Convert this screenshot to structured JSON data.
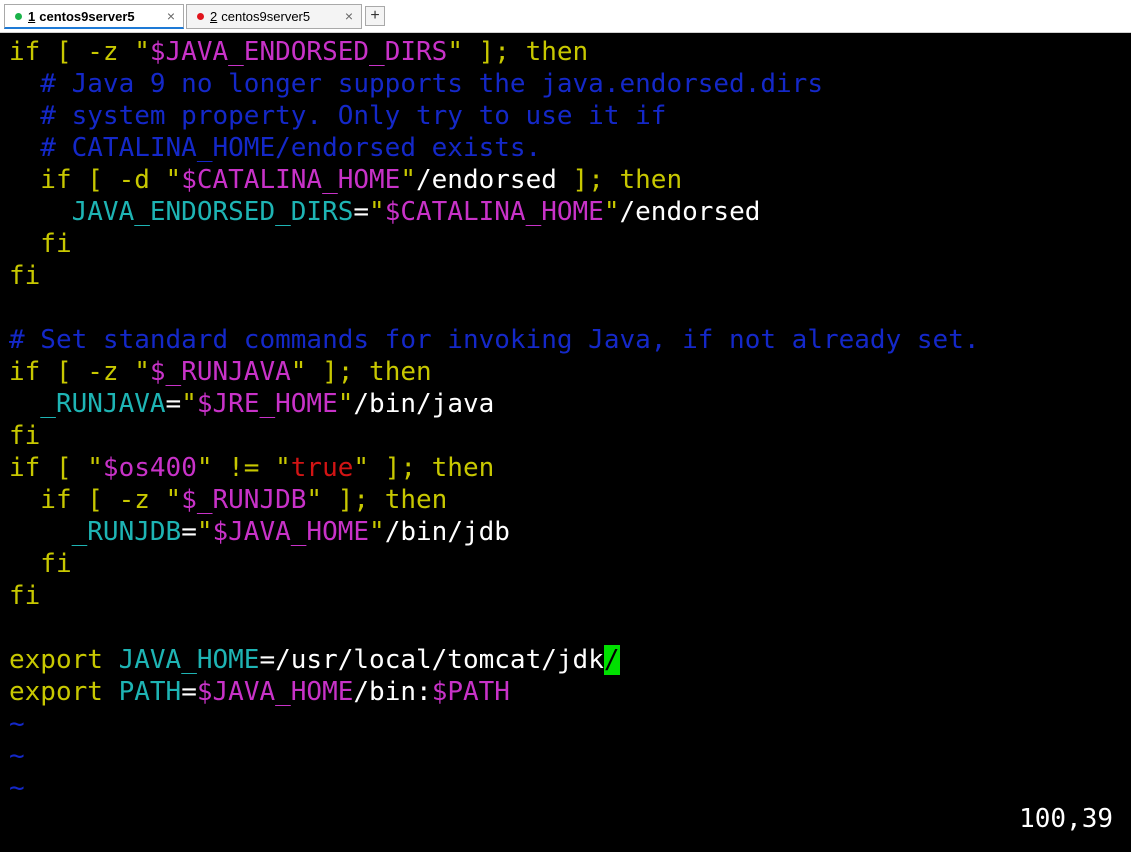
{
  "tabs": [
    {
      "number": "1",
      "title": "centos9server5",
      "dot_color": "#1bb34a",
      "active": true,
      "close": "×"
    },
    {
      "number": "2",
      "title": "centos9server5",
      "dot_color": "#e0141c",
      "active": false,
      "close": "×"
    }
  ],
  "new_tab_label": "+",
  "colors": {
    "yellow": "#c8c800",
    "magenta": "#c832c8",
    "blue": "#1428c8",
    "cyan": "#1eb4b4",
    "red": "#d21414",
    "white": "#ffffff",
    "cursor": "#00e000"
  },
  "editor": {
    "lines": [
      [
        {
          "t": "if [ -z \"",
          "c": "yellow"
        },
        {
          "t": "$JAVA_ENDORSED_DIRS",
          "c": "magenta"
        },
        {
          "t": "\" ]; then",
          "c": "yellow"
        }
      ],
      [
        {
          "t": "  # Java 9 no longer supports the java.endorsed.dirs",
          "c": "blue"
        }
      ],
      [
        {
          "t": "  # system property. Only try to use it if",
          "c": "blue"
        }
      ],
      [
        {
          "t": "  # CATALINA_HOME/endorsed exists.",
          "c": "blue"
        }
      ],
      [
        {
          "t": "  if [ -d \"",
          "c": "yellow"
        },
        {
          "t": "$CATALINA_HOME",
          "c": "magenta"
        },
        {
          "t": "\"",
          "c": "yellow"
        },
        {
          "t": "/endorsed",
          "c": "white"
        },
        {
          "t": " ]; then",
          "c": "yellow"
        }
      ],
      [
        {
          "t": "    JAVA_ENDORSED_DIRS",
          "c": "cyan"
        },
        {
          "t": "=",
          "c": "white"
        },
        {
          "t": "\"",
          "c": "yellow"
        },
        {
          "t": "$CATALINA_HOME",
          "c": "magenta"
        },
        {
          "t": "\"",
          "c": "yellow"
        },
        {
          "t": "/endorsed",
          "c": "white"
        }
      ],
      [
        {
          "t": "  fi",
          "c": "yellow"
        }
      ],
      [
        {
          "t": "fi",
          "c": "yellow"
        }
      ],
      [],
      [
        {
          "t": "# Set standard commands for invoking Java, if not already set.",
          "c": "blue"
        }
      ],
      [
        {
          "t": "if [ -z \"",
          "c": "yellow"
        },
        {
          "t": "$_RUNJAVA",
          "c": "magenta"
        },
        {
          "t": "\" ]; then",
          "c": "yellow"
        }
      ],
      [
        {
          "t": "  _RUNJAVA",
          "c": "cyan"
        },
        {
          "t": "=",
          "c": "white"
        },
        {
          "t": "\"",
          "c": "yellow"
        },
        {
          "t": "$JRE_HOME",
          "c": "magenta"
        },
        {
          "t": "\"",
          "c": "yellow"
        },
        {
          "t": "/bin/java",
          "c": "white"
        }
      ],
      [
        {
          "t": "fi",
          "c": "yellow"
        }
      ],
      [
        {
          "t": "if [ \"",
          "c": "yellow"
        },
        {
          "t": "$os400",
          "c": "magenta"
        },
        {
          "t": "\" != \"",
          "c": "yellow"
        },
        {
          "t": "true",
          "c": "red"
        },
        {
          "t": "\" ]; then",
          "c": "yellow"
        }
      ],
      [
        {
          "t": "  if [ -z \"",
          "c": "yellow"
        },
        {
          "t": "$_RUNJDB",
          "c": "magenta"
        },
        {
          "t": "\" ]; then",
          "c": "yellow"
        }
      ],
      [
        {
          "t": "    _RUNJDB",
          "c": "cyan"
        },
        {
          "t": "=",
          "c": "white"
        },
        {
          "t": "\"",
          "c": "yellow"
        },
        {
          "t": "$JAVA_HOME",
          "c": "magenta"
        },
        {
          "t": "\"",
          "c": "yellow"
        },
        {
          "t": "/bin/jdb",
          "c": "white"
        }
      ],
      [
        {
          "t": "  fi",
          "c": "yellow"
        }
      ],
      [
        {
          "t": "fi",
          "c": "yellow"
        }
      ],
      [],
      [
        {
          "t": "export ",
          "c": "yellow"
        },
        {
          "t": "JAVA_HOME",
          "c": "cyan"
        },
        {
          "t": "=/usr/local/tomcat/jdk",
          "c": "white"
        },
        {
          "t": "/",
          "c": "cursor"
        }
      ],
      [
        {
          "t": "export ",
          "c": "yellow"
        },
        {
          "t": "PATH",
          "c": "cyan"
        },
        {
          "t": "=",
          "c": "white"
        },
        {
          "t": "$JAVA_HOME",
          "c": "magenta"
        },
        {
          "t": "/bin:",
          "c": "white"
        },
        {
          "t": "$PATH",
          "c": "magenta"
        }
      ],
      [
        {
          "t": "~",
          "c": "blue"
        }
      ],
      [
        {
          "t": "~",
          "c": "blue"
        }
      ],
      [
        {
          "t": "~",
          "c": "blue"
        }
      ]
    ],
    "cursor_position": "100,39"
  }
}
